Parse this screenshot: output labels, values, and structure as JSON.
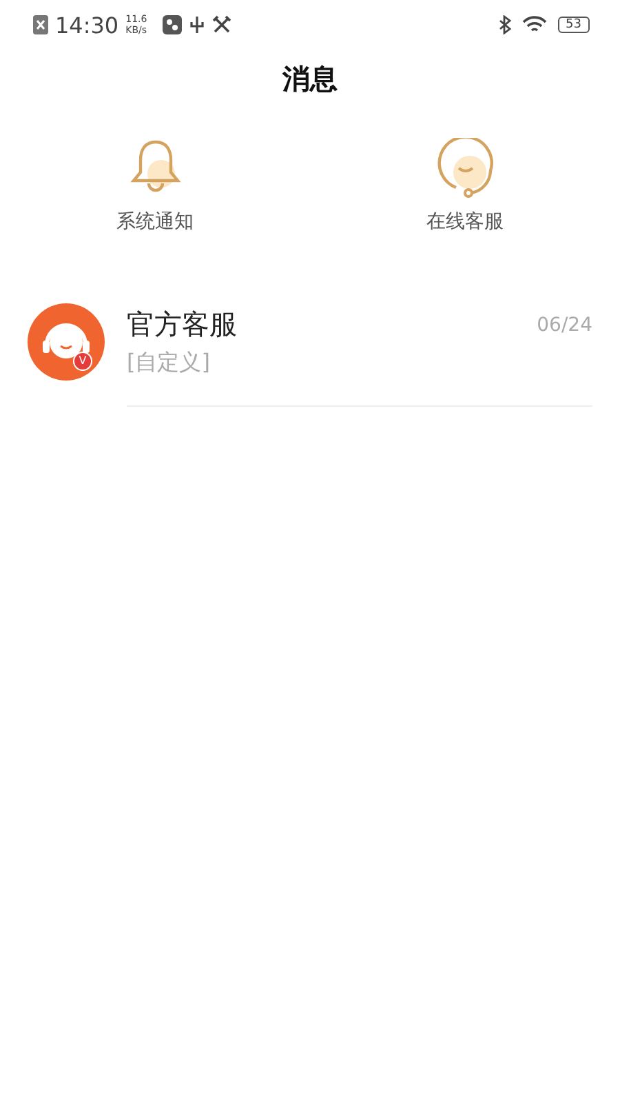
{
  "status_bar": {
    "time": "14:30",
    "speed_value": "11.6",
    "speed_unit": "KB/s",
    "battery": "53"
  },
  "title": "消息",
  "shortcuts": [
    {
      "kind": "bell",
      "label": "系统通知"
    },
    {
      "kind": "support",
      "label": "在线客服"
    }
  ],
  "conversations": [
    {
      "name": "官方客服",
      "preview": "[自定义]",
      "date": "06/24",
      "badge": "V"
    }
  ]
}
